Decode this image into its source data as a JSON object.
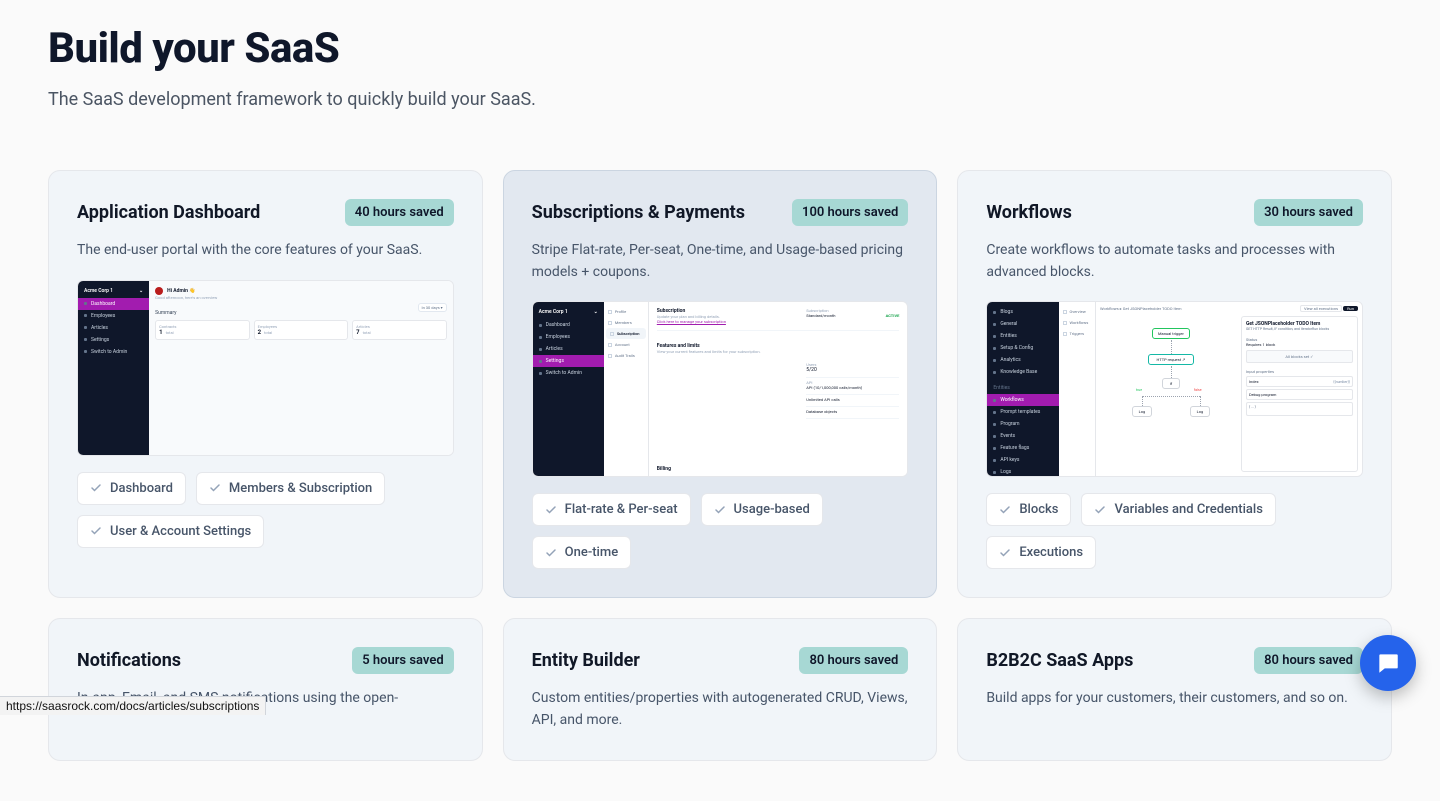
{
  "header": {
    "title": "Build your SaaS",
    "subtitle": "The SaaS development framework to quickly build your SaaS."
  },
  "statusbar": "https://saasrock.com/docs/articles/subscriptions",
  "cards": [
    {
      "title": "Application Dashboard",
      "badge": "40 hours saved",
      "desc": "The end-user portal with the core features of your SaaS.",
      "tags": [
        "Dashboard",
        "Members & Subscription",
        "User & Account Settings"
      ],
      "preview": {
        "org": "Acme Corp 1",
        "sideItems": [
          "Dashboard",
          "Employees",
          "Articles",
          "Settings",
          "Switch to Admin"
        ],
        "activeIndex": 0,
        "user": "Hi Admin 👋",
        "userSub": "Good afternoon, here's an overview",
        "summaryLabel": "Summary",
        "pill": "In 30 days ▾",
        "stats": [
          {
            "label": "Contracts",
            "value": "1",
            "sub": "total"
          },
          {
            "label": "Employees",
            "value": "2",
            "sub": "total"
          },
          {
            "label": "Articles",
            "value": "7",
            "sub": "total"
          }
        ]
      }
    },
    {
      "title": "Subscriptions & Payments",
      "badge": "100 hours saved",
      "desc": "Stripe Flat-rate, Per-seat, One-time, and Usage-based pricing models + coupons.",
      "tags": [
        "Flat-rate & Per-seat",
        "Usage-based",
        "One-time"
      ],
      "preview": {
        "org": "Acme Corp 1",
        "sideItems": [
          "Dashboard",
          "Employees",
          "Articles",
          "Settings",
          "Switch to Admin"
        ],
        "activeIndex": 3,
        "midItems": [
          "Profile",
          "Members",
          "Subscription",
          "Account",
          "Audit Trails"
        ],
        "midActive": 2,
        "heading": "Subscription",
        "subheading": "Update your plan and billing details.",
        "link": "Click here to manage your subscription",
        "subscriptionLabel": "Subscription",
        "subscriptionValue": "Standard/month",
        "status": "ACTIVE",
        "section2": "Features and limits",
        "section2sub": "View your current features and limits for your subscription.",
        "usersLabel": "Users",
        "usersValue": "5/20",
        "apiLabel": "API",
        "apiSub1": "API (10/1,000,000 calls/month)",
        "apiSub2": "Unlimited API calls",
        "apiSub3": "Database objects",
        "section3": "Billing"
      }
    },
    {
      "title": "Workflows",
      "badge": "30 hours saved",
      "desc": "Create workflows to automate tasks and processes with advanced blocks.",
      "tags": [
        "Blocks",
        "Variables and Credentials",
        "Executions"
      ],
      "preview": {
        "sideItems": [
          "Blogs",
          "General",
          "Entities",
          "Setup & Config",
          "Analytics",
          "Knowledge Base",
          "Entities",
          "Workflows",
          "Prompt templates",
          "Program",
          "Events",
          "Feature flags",
          "API keys",
          "Logs"
        ],
        "activeIndex": 7,
        "midItems": [
          "Overview",
          "Workflows",
          "Triggers"
        ],
        "crumbLeft": "Workflows ▸ Get JSONPlaceholder TODO Item",
        "crumbBtn1": "View all executions",
        "crumbBtn2": "Run",
        "node1": "Manual trigger",
        "node2": "HTTP request ↗",
        "node3": "if",
        "node3l": "true",
        "node3r": "false",
        "node4": "Log",
        "node5": "Log",
        "panelTitle": "Get JSONPlaceholder TODO Item",
        "panelSub": "GET HTTP Result, IF condition, and IteratorRun blocks",
        "statusLbl": "Status",
        "statusVal": "Requires 1 block",
        "boxText": "All blocks set ✓",
        "inputsLbl": "Input properties",
        "input1": "Index",
        "input1tag": "{{number}}",
        "input2": "Debug program",
        "codeTop": "{\n  ...\n}"
      }
    },
    {
      "title": "Notifications",
      "badge": "5 hours saved",
      "desc": "In-app, Email, and SMS notifications using the open-"
    },
    {
      "title": "Entity Builder",
      "badge": "80 hours saved",
      "desc": "Custom entities/properties with autogenerated CRUD, Views, API, and more."
    },
    {
      "title": "B2B2C SaaS Apps",
      "badge": "80 hours saved",
      "desc": "Build apps for your customers, their customers, and so on."
    }
  ]
}
